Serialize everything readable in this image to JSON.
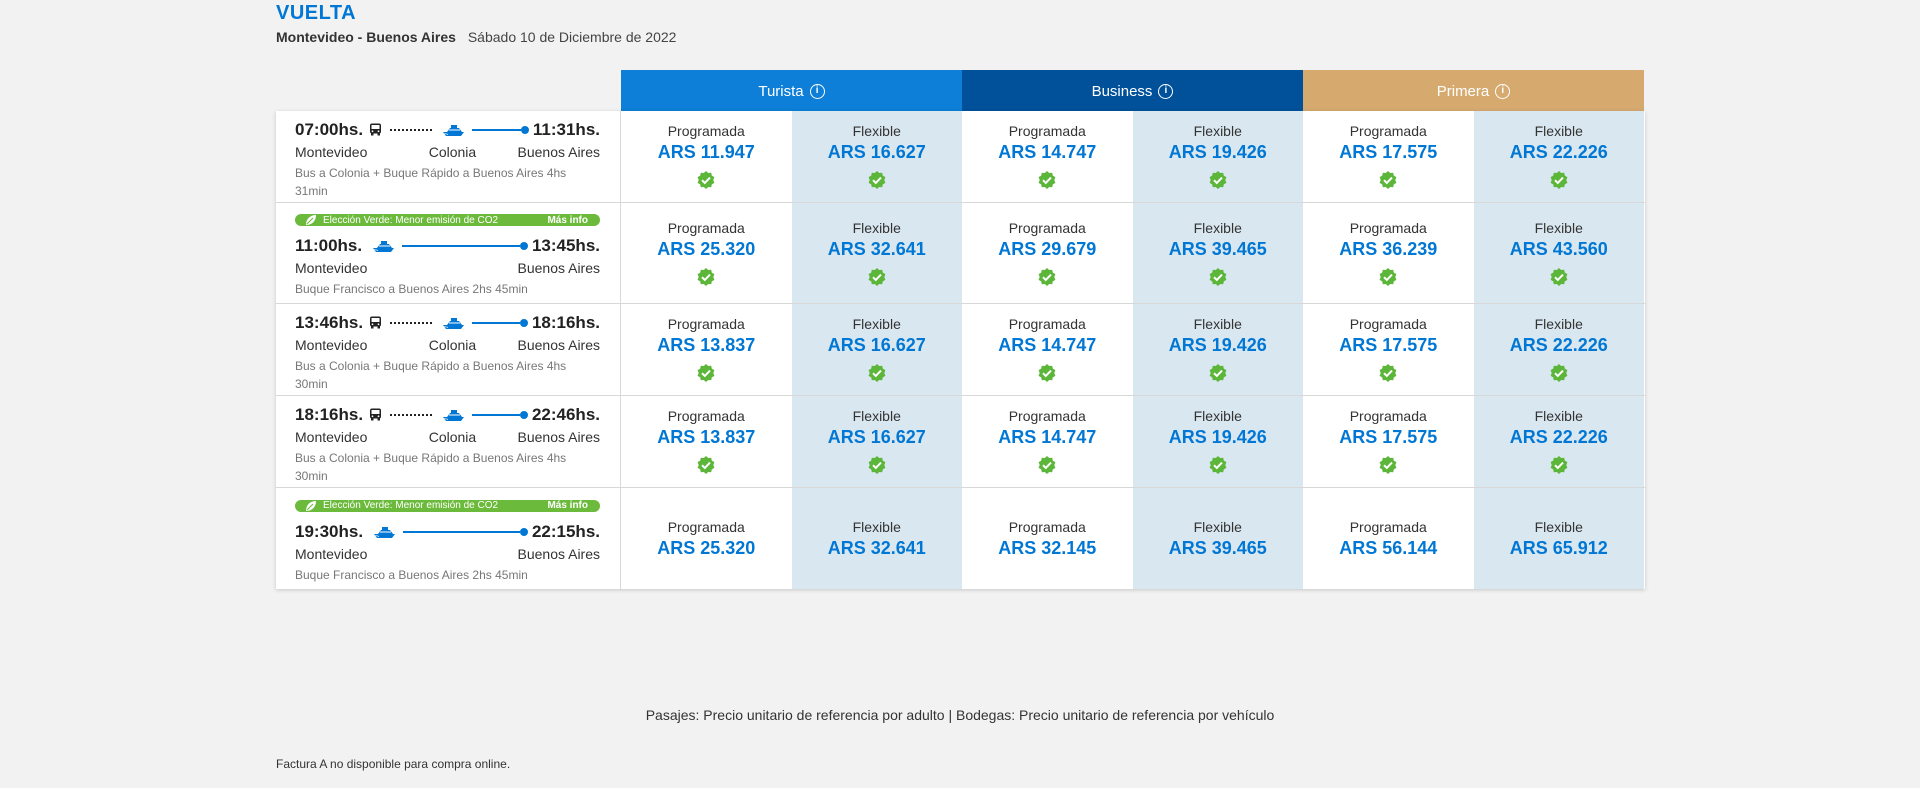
{
  "header": {
    "title": "VUELTA",
    "route": "Montevideo - Buenos Aires",
    "date": "Sábado 10 de Diciembre de 2022"
  },
  "classes": {
    "turista": "Turista",
    "business": "Business",
    "primera": "Primera"
  },
  "colors": {
    "turista": "#0d7fd8",
    "business": "#00519a",
    "primera": "#d6aa6f",
    "price": "#0077d4",
    "eco": "#6cba3c",
    "flexible_bg": "#d9e7f0"
  },
  "eco_badge": {
    "text": "Elección Verde: Menor emisión de CO2",
    "more": "Más info"
  },
  "fare_labels": {
    "programada": "Programada",
    "flexible": "Flexible"
  },
  "trips": [
    {
      "eco": false,
      "type": "bus-ship",
      "depart": "07:00hs.",
      "arrive": "11:31hs.",
      "origin": "Montevideo",
      "via": "Colonia",
      "destination": "Buenos Aires",
      "description": "Bus a Colonia + Buque Rápido a Buenos Aires 4hs 31min",
      "prices": [
        "ARS 11.947",
        "ARS 16.627",
        "ARS 14.747",
        "ARS 19.426",
        "ARS 17.575",
        "ARS 22.226"
      ],
      "available": true
    },
    {
      "eco": true,
      "type": "ship",
      "depart": "11:00hs.",
      "arrive": "13:45hs.",
      "origin": "Montevideo",
      "via": "",
      "destination": "Buenos Aires",
      "description": "Buque Francisco a Buenos Aires 2hs 45min",
      "prices": [
        "ARS 25.320",
        "ARS 32.641",
        "ARS 29.679",
        "ARS 39.465",
        "ARS 36.239",
        "ARS 43.560"
      ],
      "available": true
    },
    {
      "eco": false,
      "type": "bus-ship",
      "depart": "13:46hs.",
      "arrive": "18:16hs.",
      "origin": "Montevideo",
      "via": "Colonia",
      "destination": "Buenos Aires",
      "description": "Bus a Colonia + Buque Rápido a Buenos Aires 4hs 30min",
      "prices": [
        "ARS 13.837",
        "ARS 16.627",
        "ARS 14.747",
        "ARS 19.426",
        "ARS 17.575",
        "ARS 22.226"
      ],
      "available": true
    },
    {
      "eco": false,
      "type": "bus-ship",
      "depart": "18:16hs.",
      "arrive": "22:46hs.",
      "origin": "Montevideo",
      "via": "Colonia",
      "destination": "Buenos Aires",
      "description": "Bus a Colonia + Buque Rápido a Buenos Aires 4hs 30min",
      "prices": [
        "ARS 13.837",
        "ARS 16.627",
        "ARS 14.747",
        "ARS 19.426",
        "ARS 17.575",
        "ARS 22.226"
      ],
      "available": true
    },
    {
      "eco": true,
      "type": "ship",
      "depart": "19:30hs.",
      "arrive": "22:15hs.",
      "origin": "Montevideo",
      "via": "",
      "destination": "Buenos Aires",
      "description": "Buque Francisco a Buenos Aires 2hs 45min",
      "prices": [
        "ARS 25.320",
        "ARS 32.641",
        "ARS 32.145",
        "ARS 39.465",
        "ARS 56.144",
        "ARS 65.912"
      ],
      "available": false
    }
  ],
  "footnote": "Pasajes: Precio unitario de referencia por adulto | Bodegas: Precio unitario de referencia por vehículo",
  "footer": "Factura A no disponible para compra online."
}
